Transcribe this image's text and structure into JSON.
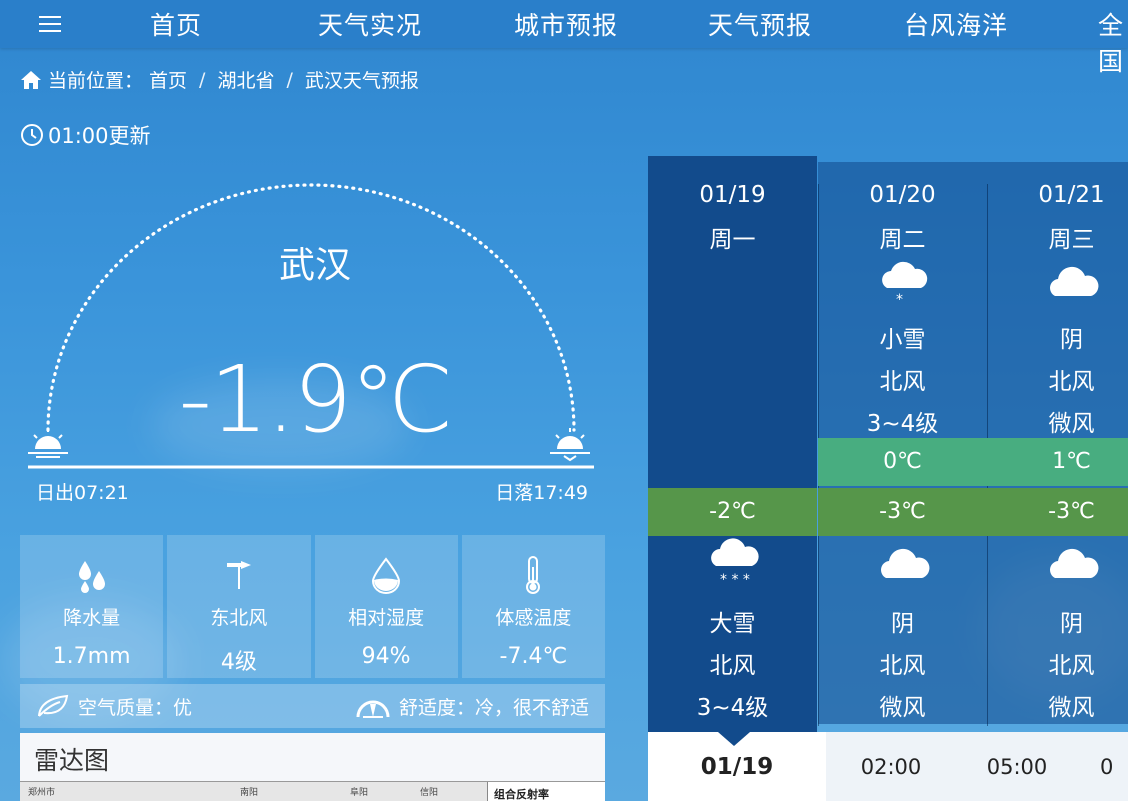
{
  "nav": {
    "menu_icon": "hamburger-menu-icon",
    "items": [
      "首页",
      "天气实况",
      "城市预报",
      "天气预报",
      "台风海洋",
      "全国"
    ]
  },
  "breadcrumb": {
    "prefix": "当前位置：",
    "items": [
      "首页",
      "湖北省",
      "武汉天气预报"
    ],
    "separator": "/"
  },
  "update_time": "01:00更新",
  "current": {
    "city": "武汉",
    "temperature": "-1.9℃",
    "sunrise": "日出07:21",
    "sunset": "日落17:49"
  },
  "stats": [
    {
      "icon": "raindrops-icon",
      "label": "降水量",
      "value": "1.7mm"
    },
    {
      "icon": "wind-vane-icon",
      "label": "东北风",
      "value": "4级"
    },
    {
      "icon": "humidity-drop-icon",
      "label": "相对湿度",
      "value": "94%"
    },
    {
      "icon": "thermometer-icon",
      "label": "体感温度",
      "value": "-7.4℃"
    }
  ],
  "air_quality": "空气质量：优",
  "comfort": "舒适度：冷，很不舒适",
  "radar": {
    "title": "雷达图",
    "legend_title": "组合反射率",
    "map_labels": [
      "郑州市",
      "南阳",
      "信阳",
      "阜阳",
      "许昌"
    ]
  },
  "forecast": [
    {
      "date": "01/19",
      "weekday": "周一",
      "selected": true,
      "day_cond": "",
      "day_wind": "",
      "day_level": "",
      "high": "",
      "low": "-2℃",
      "night_icon": "heavy-snow-icon",
      "night_cond": "大雪",
      "night_wind": "北风",
      "night_level": "3~4级"
    },
    {
      "date": "01/20",
      "weekday": "周二",
      "selected": false,
      "day_icon": "light-snow-icon",
      "day_cond": "小雪",
      "day_wind": "北风",
      "day_level": "3~4级",
      "high": "0℃",
      "low": "-3℃",
      "night_icon": "overcast-cloud-icon",
      "night_cond": "阴",
      "night_wind": "北风",
      "night_level": "微风"
    },
    {
      "date": "01/21",
      "weekday": "周三",
      "selected": false,
      "day_icon": "overcast-cloud-icon",
      "day_cond": "阴",
      "day_wind": "北风",
      "day_level": "微风",
      "high": "1℃",
      "low": "-3℃",
      "night_icon": "overcast-cloud-icon",
      "night_cond": "阴",
      "night_wind": "北风",
      "night_level": "微风"
    }
  ],
  "hourly": {
    "active_date": "01/19",
    "times": [
      "02:00",
      "05:00",
      "0"
    ]
  },
  "colors": {
    "nav_bg": "#2a7fca",
    "selected_day_bg": "#124b8c",
    "high_temp_bg": "#48ad80",
    "low_temp_bg": "#56964a"
  }
}
